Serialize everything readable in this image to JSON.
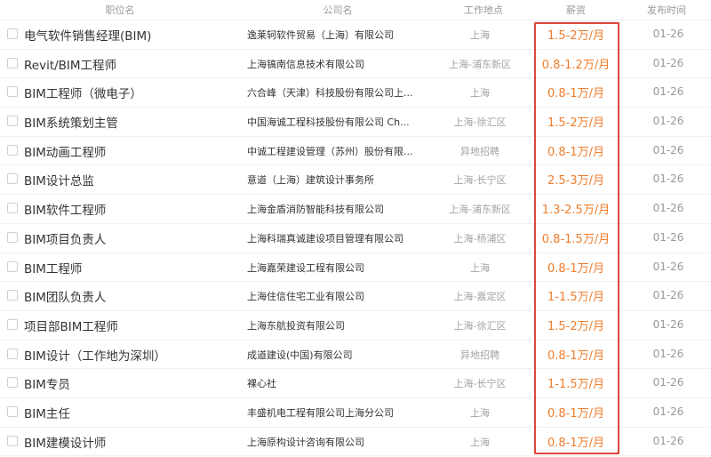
{
  "header": {
    "title": "职位名",
    "company": "公司名",
    "location": "工作地点",
    "salary": "薪资",
    "date": "发布时间"
  },
  "rows": [
    {
      "title": "电气软件销售经理(BIM)",
      "company": "逸莱轲软件贸易（上海）有限公司",
      "location": "上海",
      "salary": "1.5-2万/月",
      "date": "01-26"
    },
    {
      "title": "Revit/BIM工程师",
      "company": "上海镐南信息技术有限公司",
      "location": "上海-浦东新区",
      "salary": "0.8-1.2万/月",
      "date": "01-26"
    },
    {
      "title": "BIM工程师（微电子）",
      "company": "六合峰（天津）科技股份有限公司上...",
      "location": "上海",
      "salary": "0.8-1万/月",
      "date": "01-26"
    },
    {
      "title": "BIM系统策划主管",
      "company": "中国海诚工程科技股份有限公司 Ch...",
      "location": "上海-徐汇区",
      "salary": "1.5-2万/月",
      "date": "01-26"
    },
    {
      "title": "BIM动画工程师",
      "company": "中诚工程建设管理（苏州）股份有限...",
      "location": "异地招聘",
      "salary": "0.8-1万/月",
      "date": "01-26"
    },
    {
      "title": "BIM设计总监",
      "company": "意道（上海）建筑设计事务所",
      "location": "上海-长宁区",
      "salary": "2.5-3万/月",
      "date": "01-26"
    },
    {
      "title": "BIM软件工程师",
      "company": "上海金盾消防智能科技有限公司",
      "location": "上海-浦东新区",
      "salary": "1.3-2.5万/月",
      "date": "01-26"
    },
    {
      "title": "BIM项目负责人",
      "company": "上海科瑞真诚建设项目管理有限公司",
      "location": "上海-杨浦区",
      "salary": "0.8-1.5万/月",
      "date": "01-26"
    },
    {
      "title": "BIM工程师",
      "company": "上海嘉荣建设工程有限公司",
      "location": "上海",
      "salary": "0.8-1万/月",
      "date": "01-26"
    },
    {
      "title": "BIM团队负责人",
      "company": "上海住信住宅工业有限公司",
      "location": "上海-嘉定区",
      "salary": "1-1.5万/月",
      "date": "01-26"
    },
    {
      "title": "项目部BIM工程师",
      "company": "上海东航投资有限公司",
      "location": "上海-徐汇区",
      "salary": "1.5-2万/月",
      "date": "01-26"
    },
    {
      "title": "BIM设计（工作地为深圳）",
      "company": "成道建设(中国)有限公司",
      "location": "异地招聘",
      "salary": "0.8-1万/月",
      "date": "01-26"
    },
    {
      "title": "BIM专员",
      "company": "裸心社",
      "location": "上海-长宁区",
      "salary": "1-1.5万/月",
      "date": "01-26"
    },
    {
      "title": "BIM主任",
      "company": "丰盛机电工程有限公司上海分公司",
      "location": "上海",
      "salary": "0.8-1万/月",
      "date": "01-26"
    },
    {
      "title": "BIM建模设计师",
      "company": "上海原构设计咨询有限公司",
      "location": "上海",
      "salary": "0.8-1万/月",
      "date": "01-26"
    }
  ],
  "colors": {
    "salary": "#f07d2c",
    "highlight_box": "#e0463a",
    "muted": "#999999"
  }
}
